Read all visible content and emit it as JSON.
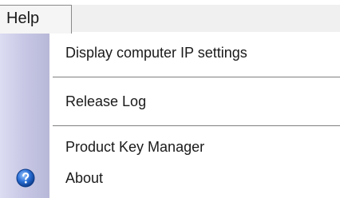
{
  "menubar": {
    "open_menu_label": "Help"
  },
  "menu": {
    "items": [
      {
        "label": "Display computer IP settings",
        "icon": null
      },
      {
        "label": "Release Log",
        "icon": null
      },
      {
        "label": "Product Key Manager",
        "icon": null
      },
      {
        "label": "About",
        "icon": "help-question-icon"
      }
    ]
  },
  "colors": {
    "icon_blue": "#2a6fd6"
  }
}
